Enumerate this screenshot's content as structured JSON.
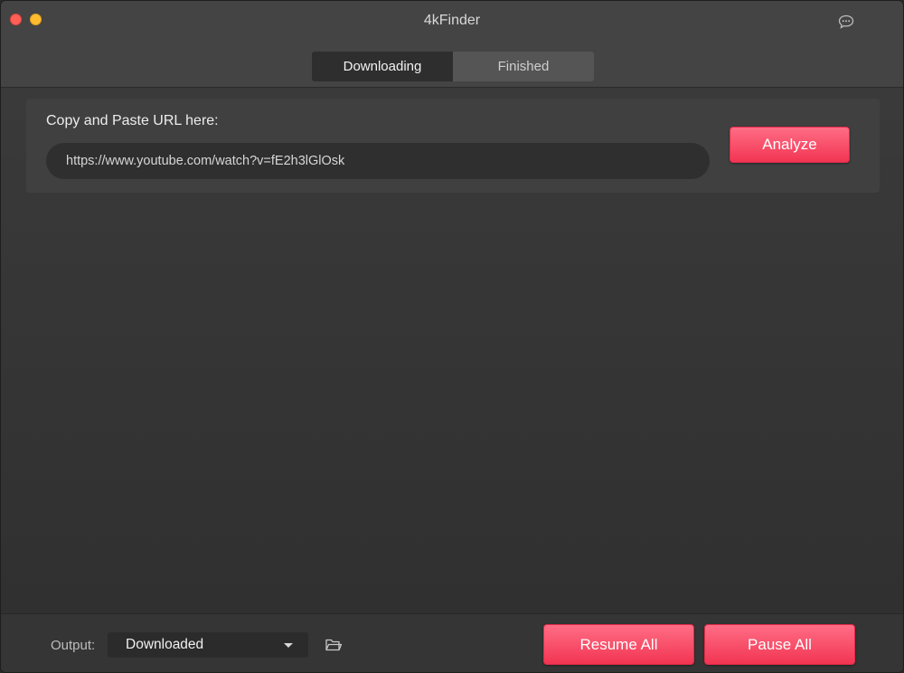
{
  "window": {
    "title": "4kFinder"
  },
  "tabs": [
    {
      "label": "Downloading",
      "active": true
    },
    {
      "label": "Finished",
      "active": false
    }
  ],
  "url_panel": {
    "label": "Copy and Paste URL here:",
    "url_value": "https://www.youtube.com/watch?v=fE2h3lGlOsk",
    "analyze_label": "Analyze"
  },
  "bottom": {
    "output_label": "Output:",
    "output_value": "Downloaded",
    "resume_label": "Resume All",
    "pause_label": "Pause All"
  },
  "icons": {
    "chat": "chat-bubble-icon",
    "folder": "folder-icon",
    "dropdown": "chevron-down-icon"
  },
  "colors": {
    "accent": "#f23553",
    "background": "#303030",
    "close": "#fe5f57",
    "minimize": "#febc2e"
  }
}
